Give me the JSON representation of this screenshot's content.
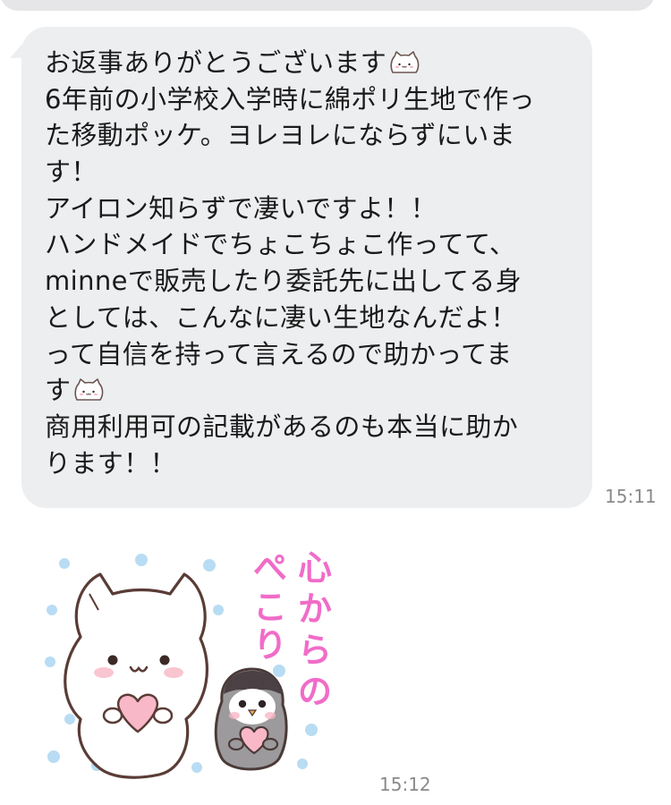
{
  "message": {
    "lines": [
      {
        "text": "お返事ありがとうございます",
        "emoji": "cat-face-icon"
      },
      {
        "text": "6年前の小学校入学時に綿ポリ生地で作っ"
      },
      {
        "text": "た移動ポッケ。ヨレヨレにならずにいま"
      },
      {
        "text": "す！"
      },
      {
        "text": "アイロン知らずで凄いですよ！！"
      },
      {
        "text": "ハンドメイドでちょこちょこ作ってて、"
      },
      {
        "text": "minneで販売したり委託先に出してる身"
      },
      {
        "text": "としては、こんなに凄い生地なんだよ！"
      },
      {
        "text": "って自信を持って言えるので助かってま"
      },
      {
        "text": "す",
        "emoji": "cat-face-icon"
      },
      {
        "text": "商用利用可の記載があるのも本当に助か"
      },
      {
        "text": "ります！！"
      }
    ],
    "time": "15:11"
  },
  "sticker": {
    "caption": "心からのぺこり",
    "characters": [
      "cat-icon",
      "penguin-icon"
    ],
    "time": "15:12"
  },
  "colors": {
    "bubble": "#edeef0",
    "text": "#1a1a1a",
    "time": "#8a8a8a",
    "sticker_text": "#f06cc8",
    "dots": "#a9d4f0"
  }
}
